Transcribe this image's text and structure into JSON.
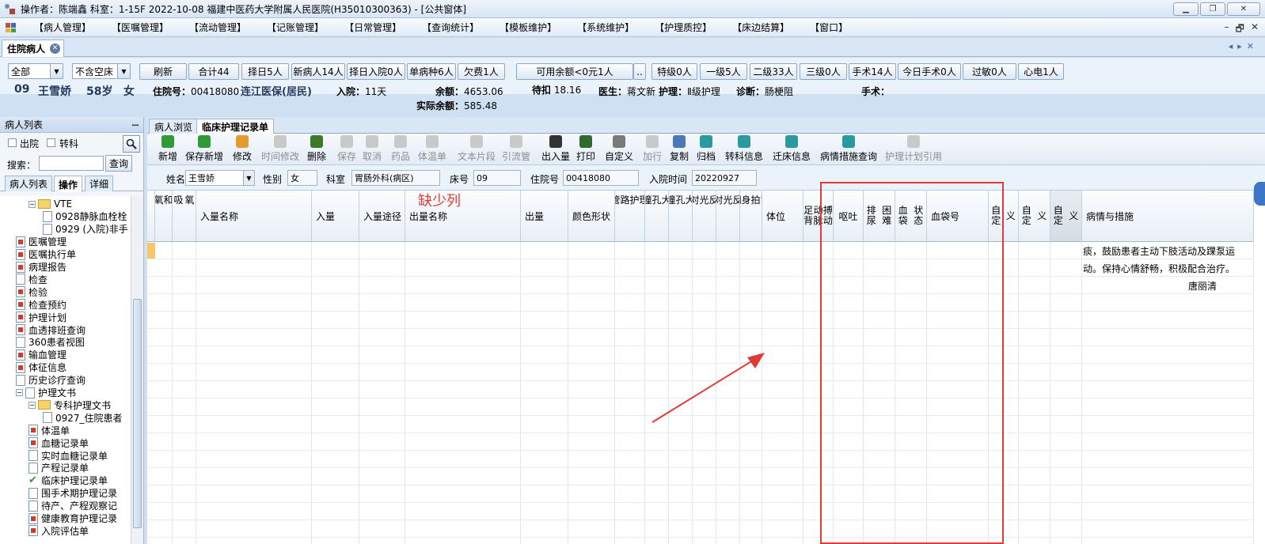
{
  "window": {
    "title": "操作者：陈端鑫  科室：1-15F  2022-10-08  福建中医药大学附属人民医院(H35010300363) - [公共窗体]",
    "controls": [
      "▁",
      "❐",
      "✕"
    ]
  },
  "menu": {
    "items": [
      "【病人管理】",
      "【医嘱管理】",
      "【流动管理】",
      "【记账管理】",
      "【日常管理】",
      "【查询统计】",
      "【模板维护】",
      "【系统维护】",
      "【护理质控】",
      "【床边结算】",
      "【窗口】"
    ],
    "mdi_controls": [
      "–",
      "🗗",
      "✕"
    ]
  },
  "doc_tab": {
    "label": "住院病人"
  },
  "filter": {
    "scope_value": "全部",
    "bed_value": "不含空床",
    "buttons": [
      "刷新",
      "合计44",
      "择日5人",
      "新病人14人",
      "择日入院0人",
      "单病种6人",
      "欠费1人"
    ],
    "balance_button": "可用余额<0元1人",
    "balance_more": "..",
    "level_buttons": [
      "特级0人",
      "一级5人",
      "二级33人",
      "三级0人",
      "手术14人",
      "今日手术0人",
      "过敏0人",
      "心电1人"
    ]
  },
  "patient": {
    "bed": "09",
    "name": "王雪娇",
    "age": "58岁",
    "sex": "女",
    "admission_no_label": "住院号：",
    "admission_no": "00418080",
    "insurance": "连江医保(居民)",
    "stay_label": "入院：",
    "stay": "11天",
    "balance_label": "余额：",
    "balance": "4653.06",
    "actual_balance_label": "实际余额：",
    "actual_balance": "585.48",
    "pending_label": "待扣",
    "pending": "18.16",
    "doctor_label": "医生：",
    "doctor": "蒋文新",
    "nursing_label": "护理：",
    "nursing": "Ⅱ级护理",
    "diagnosis_label": "诊断：",
    "diagnosis": "肠梗阻",
    "surgery_label": "手术："
  },
  "left_panel": {
    "header": "病人列表",
    "pin": "ꟷ",
    "discharge_label": "出院",
    "transfer_label": "转科",
    "search_label": "搜索：",
    "search_value": "",
    "query_button": "查询",
    "tabs": [
      "病人列表",
      "操作",
      "详细"
    ],
    "tree": [
      {
        "label": "VTE",
        "level": 1,
        "icon": "folder",
        "expander": "−"
      },
      {
        "label": "0928静脉血栓栓",
        "level": 2,
        "icon": "doc"
      },
      {
        "label": "0929 (入院)非手",
        "level": 2,
        "icon": "doc"
      },
      {
        "label": "医嘱管理",
        "level": 0,
        "icon": "red"
      },
      {
        "label": "医嘱执行单",
        "level": 0,
        "icon": "red"
      },
      {
        "label": "病理报告",
        "level": 0,
        "icon": "red"
      },
      {
        "label": "检查",
        "level": 0,
        "icon": "doc"
      },
      {
        "label": "检验",
        "level": 0,
        "icon": "red"
      },
      {
        "label": "检查预约",
        "level": 0,
        "icon": "red"
      },
      {
        "label": "护理计划",
        "level": 0,
        "icon": "red"
      },
      {
        "label": "血透排班查询",
        "level": 0,
        "icon": "red"
      },
      {
        "label": "360患者视图",
        "level": 0,
        "icon": "doc"
      },
      {
        "label": "输血管理",
        "level": 0,
        "icon": "red"
      },
      {
        "label": "体征信息",
        "level": 0,
        "icon": "red"
      },
      {
        "label": "历史诊疗查询",
        "level": 0,
        "icon": "doc"
      },
      {
        "label": "护理文书",
        "level": 0,
        "icon": "doc",
        "expander": "−"
      },
      {
        "label": "专科护理文书",
        "level": 1,
        "icon": "folder",
        "expander": "−"
      },
      {
        "label": "0927_住院患者",
        "level": 2,
        "icon": "doc"
      },
      {
        "label": "体温单",
        "level": 1,
        "icon": "red"
      },
      {
        "label": "血糖记录单",
        "level": 1,
        "icon": "red"
      },
      {
        "label": "实时血糖记录单",
        "level": 1,
        "icon": "doc"
      },
      {
        "label": "产程记录单",
        "level": 1,
        "icon": "doc"
      },
      {
        "label": "临床护理记录单",
        "level": 1,
        "icon": "check"
      },
      {
        "label": "围手术期护理记录",
        "level": 1,
        "icon": "doc"
      },
      {
        "label": "待产、产程观察记",
        "level": 1,
        "icon": "doc"
      },
      {
        "label": "健康教育护理记录",
        "level": 1,
        "icon": "red"
      },
      {
        "label": "入院评估单",
        "level": 1,
        "icon": "red"
      }
    ]
  },
  "main": {
    "tabs": [
      "病人浏览",
      "临床护理记录单"
    ],
    "toolbar": [
      {
        "label": "新增",
        "enabled": true,
        "color": "#2e9a3a"
      },
      {
        "label": "保存新增",
        "enabled": true,
        "color": "#2e9a3a"
      },
      {
        "label": "修改",
        "enabled": true,
        "color": "#e39a2e"
      },
      {
        "label": "时间修改",
        "enabled": false,
        "color": "#c9c9c9"
      },
      {
        "label": "删除",
        "enabled": true,
        "color": "#3c7a2a"
      },
      {
        "label": "保存",
        "enabled": false,
        "color": "#c9c9c9"
      },
      {
        "label": "取消",
        "enabled": false,
        "color": "#c9c9c9"
      },
      {
        "label": "药品",
        "enabled": false,
        "color": "#c9c9c9"
      },
      {
        "label": "体温单",
        "enabled": false,
        "color": "#c9c9c9"
      },
      {
        "label": "文本片段",
        "enabled": false,
        "color": "#c9c9c9"
      },
      {
        "label": "引流管",
        "enabled": false,
        "color": "#c9c9c9"
      },
      {
        "label": "出入量",
        "enabled": true,
        "color": "#333333"
      },
      {
        "label": "打印",
        "enabled": true,
        "color": "#2f6b2f"
      },
      {
        "label": "自定义",
        "enabled": true,
        "color": "#7a7a7a"
      },
      {
        "label": "加行",
        "enabled": false,
        "color": "#c9c9c9"
      },
      {
        "label": "复制",
        "enabled": true,
        "color": "#4a78b8"
      },
      {
        "label": "归档",
        "enabled": true,
        "color": "#2a9aa0"
      },
      {
        "label": "转科信息",
        "enabled": true,
        "color": "#2a9aa0"
      },
      {
        "label": "迁床信息",
        "enabled": true,
        "color": "#2a9aa0"
      },
      {
        "label": "病情措施查询",
        "enabled": true,
        "color": "#2a9aa0"
      },
      {
        "label": "护理计划引用",
        "enabled": false,
        "color": "#c9c9c9"
      }
    ],
    "patbar": {
      "name_label": "姓名",
      "name": "王雪娇",
      "sex_label": "性别",
      "sex": "女",
      "dept_label": "科室",
      "dept": "胃肠外科(病区)",
      "bed_label": "床号",
      "bed": "09",
      "adm_label": "住院号",
      "adm": "00418080",
      "date_label": "入院时间",
      "date": "20220927"
    },
    "columns": [
      "氧和",
      "吸氧",
      "入量名称",
      "入量",
      "入量途径",
      "出量名称",
      "出量",
      "颜色形状",
      "管路护理",
      "左瞳孔大小",
      "右瞳孔大小",
      "左对光反射",
      "右对光反射",
      "翻身拍背",
      "体位",
      "足背动脉搏动",
      "呕吐",
      "排尿困难",
      "血袋状态",
      "血袋号",
      "自定义",
      "自定义",
      "自定义",
      "病情与措施"
    ],
    "notes": [
      "痰，鼓励患者主动下肢活动及踝泵运",
      "动。保持心情舒畅，积极配合治疗。",
      "唐丽清"
    ]
  },
  "annotation": {
    "text": "缺少列",
    "color": "#e23a35"
  }
}
